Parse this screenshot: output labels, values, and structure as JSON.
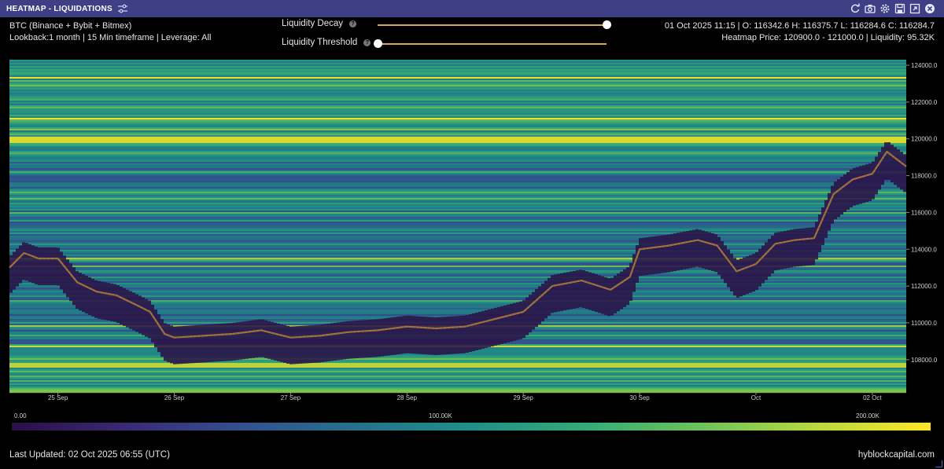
{
  "window": {
    "title": "HEATMAP - LIQUIDATIONS",
    "toolbar_icons": [
      "refresh-icon",
      "camera-icon",
      "gear-icon",
      "save-icon",
      "expand-icon",
      "close-icon"
    ]
  },
  "info": {
    "instrument": "BTC (Binance + Bybit + Bitmex)",
    "lookback": "Lookback:1 month | 15 Min timeframe | Leverage: All",
    "ohlc": "01 Oct 2025 11:15 | O: 116342.6 H: 116375.7 L: 116284.6 C: 116284.7",
    "heatmap_info": "Heatmap Price: 120900.0 - 121000.0 | Liquidity: 95.32K"
  },
  "sliders": {
    "decay_label": "Liquidity Decay",
    "threshold_label": "Liquidity Threshold",
    "decay_value": 1.0,
    "threshold_value": 0.0
  },
  "chart_data": {
    "type": "heatmap",
    "y_tick_labels": [
      "124000.0",
      "122000.0",
      "120000.0",
      "118000.0",
      "116000.0",
      "114000.0",
      "112000.0",
      "110000.0",
      "108000.0"
    ],
    "y_ticks": [
      124000,
      122000,
      120000,
      118000,
      116000,
      114000,
      112000,
      110000,
      108000
    ],
    "ylim": [
      106200,
      124300
    ],
    "x_tick_labels": [
      "25 Sep",
      "26 Sep",
      "27 Sep",
      "28 Sep",
      "29 Sep",
      "30 Sep",
      "Oct",
      "02 Oct"
    ],
    "x_ticks": [
      "2025-09-25",
      "2025-09-26",
      "2025-09-27",
      "2025-09-28",
      "2025-09-29",
      "2025-09-30",
      "2025-10-01",
      "2025-10-02"
    ],
    "x_range": [
      "2025-09-24 14:00",
      "2025-10-02 07:00"
    ],
    "colorscale": [
      "#2a0f47",
      "#3a2a73",
      "#33508e",
      "#26718c",
      "#1f8f88",
      "#33ab77",
      "#6cc35b",
      "#b8d73f",
      "#fde725"
    ],
    "colorbar_labels": [
      "0.00",
      "100.00K",
      "200.00K"
    ],
    "colorbar_range": [
      0,
      220000
    ],
    "price_path": {
      "x": [
        "2025-09-24 14:00",
        "2025-09-24 17:00",
        "2025-09-24 20:00",
        "2025-09-25 00:00",
        "2025-09-25 04:00",
        "2025-09-25 08:00",
        "2025-09-25 12:00",
        "2025-09-25 16:00",
        "2025-09-25 19:00",
        "2025-09-25 22:00",
        "2025-09-26 00:00",
        "2025-09-26 06:00",
        "2025-09-26 12:00",
        "2025-09-26 18:00",
        "2025-09-27 00:00",
        "2025-09-27 06:00",
        "2025-09-27 12:00",
        "2025-09-27 18:00",
        "2025-09-28 00:00",
        "2025-09-28 06:00",
        "2025-09-28 12:00",
        "2025-09-28 18:00",
        "2025-09-29 00:00",
        "2025-09-29 06:00",
        "2025-09-29 12:00",
        "2025-09-29 18:00",
        "2025-09-29 22:00",
        "2025-09-30 00:00",
        "2025-09-30 06:00",
        "2025-09-30 12:00",
        "2025-09-30 16:00",
        "2025-09-30 20:00",
        "2025-10-01 00:00",
        "2025-10-01 04:00",
        "2025-10-01 08:00",
        "2025-10-01 12:00",
        "2025-10-01 16:00",
        "2025-10-01 20:00",
        "2025-10-02 00:00",
        "2025-10-02 03:00",
        "2025-10-02 07:00"
      ],
      "y": [
        113000,
        113800,
        113500,
        113500,
        112200,
        111700,
        111500,
        111000,
        110600,
        109400,
        109200,
        109300,
        109400,
        109600,
        109200,
        109300,
        109500,
        109600,
        109800,
        109700,
        109800,
        110200,
        110600,
        112000,
        112300,
        111800,
        112500,
        114000,
        114200,
        114500,
        114200,
        112800,
        113200,
        114300,
        114500,
        114600,
        117000,
        117800,
        118100,
        119300,
        118500
      ]
    }
  },
  "footer": {
    "last_updated": "Last Updated: 02 Oct 2025 06:55 (UTC)",
    "brand": "hyblockcapital.com"
  }
}
